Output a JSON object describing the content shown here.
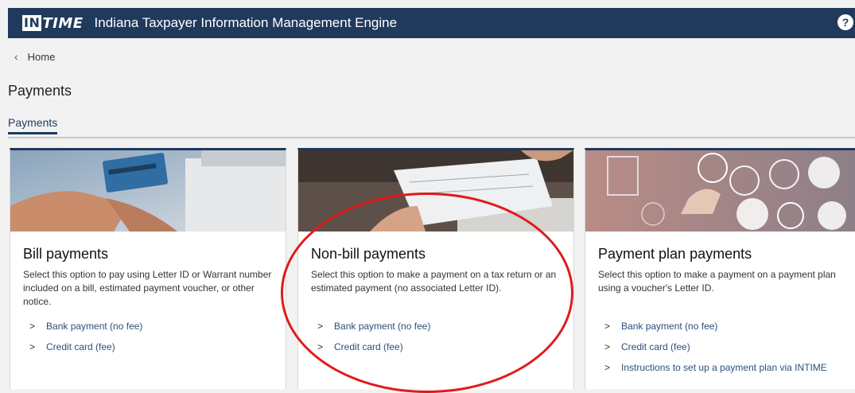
{
  "header": {
    "logo_prefix": "IN",
    "logo_suffix": "TIME",
    "title": "Indiana Taxpayer Information Management Engine",
    "help_label": "?"
  },
  "breadcrumb": {
    "label": "Home"
  },
  "page": {
    "title": "Payments"
  },
  "tabs": [
    {
      "label": "Payments"
    }
  ],
  "cards": [
    {
      "title": "Bill payments",
      "description": "Select this option to pay using Letter ID or Warrant number included on a bill, estimated payment voucher, or other notice.",
      "links": [
        "Bank payment (no fee)",
        "Credit card (fee)"
      ]
    },
    {
      "title": "Non-bill payments",
      "description": "Select this option to make a payment on a tax return or an estimated payment (no associated Letter ID).",
      "links": [
        "Bank payment (no fee)",
        "Credit card (fee)"
      ]
    },
    {
      "title": "Payment plan payments",
      "description": "Select this option to make a payment on a payment plan using a voucher's Letter ID.",
      "links": [
        "Bank payment (no fee)",
        "Credit card (fee)",
        "Instructions to set up a payment plan via INTIME"
      ]
    }
  ],
  "colors": {
    "header_bg": "#1f3a5c",
    "link": "#2b4f7e",
    "annotation": "#e01a1a"
  }
}
